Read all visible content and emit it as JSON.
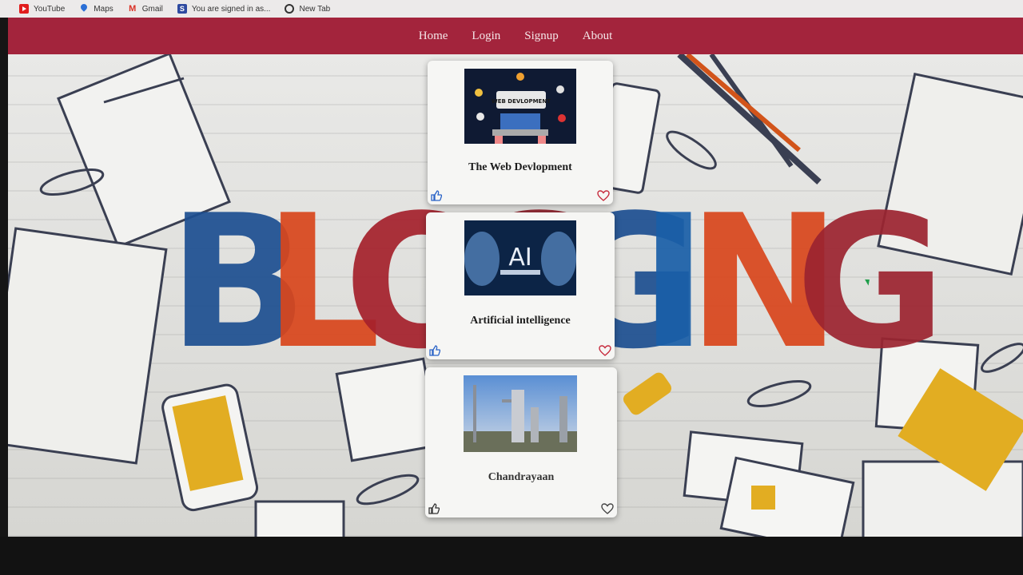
{
  "bookmarks": [
    {
      "label": "YouTube",
      "icon": "youtube-icon"
    },
    {
      "label": "Maps",
      "icon": "maps-icon"
    },
    {
      "label": "Gmail",
      "icon": "gmail-icon"
    },
    {
      "label": "You are signed in as...",
      "icon": "s-icon"
    },
    {
      "label": "New Tab",
      "icon": "globe-icon"
    }
  ],
  "nav": {
    "home": "Home",
    "login": "Login",
    "signup": "Signup",
    "about": "About"
  },
  "hero": {
    "word": "BLOGGING",
    "letter_colors": [
      "#1d4f91",
      "#d9461c",
      "#a5212c",
      "#8e1f2a",
      "#1d4f91",
      "#1a5fa8",
      "#d9461c",
      "#9c2430"
    ]
  },
  "cards": [
    {
      "title": "The Web Devlopment",
      "image_caption": "WEB DEVLOPMENT",
      "icon": "web-development-image"
    },
    {
      "title": "Artificial intelligence",
      "image_caption": "AI",
      "icon": "ai-image"
    },
    {
      "title": "Chandrayaan",
      "image_caption": "",
      "icon": "rocket-launch-image"
    }
  ],
  "colors": {
    "navbar": "#a3243c",
    "heart": "#c62a3c",
    "like": "#2a63c7"
  }
}
